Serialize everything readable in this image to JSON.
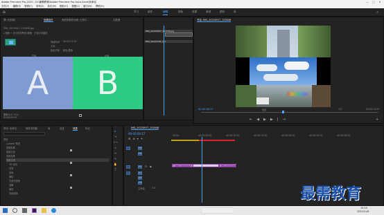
{
  "titlebar": {
    "title": "Adobe Premiere Pro 2020 - D:\\最需教育\\Adobe Premiere Pro Auto-Save\\未命名",
    "min": "—",
    "max": "□",
    "close": "✕"
  },
  "menubar": {
    "items": [
      "文件(F)",
      "编辑(E)",
      "剪辑(C)",
      "序列(S)",
      "标记(M)",
      "图形(G)",
      "视图(V)",
      "窗口(W)",
      "帮助(H)"
    ]
  },
  "workspaces": {
    "items": [
      "学习",
      "组件",
      "编辑",
      "颜色",
      "效果",
      "音频",
      "图形",
      "库"
    ],
    "active_index": 2
  },
  "effect_controls": {
    "tabs": [
      "效果控件",
      "源:(无剪辑)",
      "音频剪辑混合器: 已按计…",
      "元数据"
    ],
    "clip_title": "IMG_20220917_153408.jpg",
    "clip_line": "▸ 图像 > 未分类的黑色2图像 · 已按计划播放",
    "row_labels": [
      "持续时间",
      "方向",
      "颜色方案"
    ],
    "row_values": [
      "00:00:03:10",
      "",
      "黄色/黄绿"
    ],
    "duration_value": "00:00:03:10",
    "mode_value": "颜色/直通",
    "start_label": "开始",
    "end_label": "结束",
    "preview_a": "A",
    "preview_b": "B",
    "footer_left": "图像大小: 3/12",
    "footer_right": "00:00:00:00"
  },
  "source_mini": {
    "clips": [
      "IMG_20220917_153408.jpg",
      "IMG_20221005_1_1"
    ]
  },
  "program": {
    "tab": "节目: IMG_20220917_153408",
    "timecode": "00:00:04:17",
    "fit": "适合",
    "fraction": "1/2",
    "duration": "00:00:14:00",
    "transport": [
      "⇤",
      "◀",
      "▶",
      "▶|",
      "⇥"
    ]
  },
  "project": {
    "tabs": [
      "项目: 未命名",
      "媒体浏览器",
      "库",
      "信息",
      "效果",
      "标记"
    ],
    "active_tab": 4,
    "search_placeholder": "",
    "items": [
      "预设",
      "Lumetri 预设",
      "音频效果",
      "音频过渡",
      "视频效果",
      "视频过渡",
      "3D 运动",
      "内滑",
      "划像",
      "擦除",
      "沉浸式视频",
      "溶解",
      "缩放",
      "页面剥落"
    ]
  },
  "timeline": {
    "tab": "IMG_20220917_153408",
    "timecode": "00:00:04:17",
    "ruler": [
      "00:00",
      "00:00:05:00",
      "00:00:10:00",
      "00:00:15:00",
      "00:00:20:00",
      "00:00:25:00",
      "00:00:30:00"
    ],
    "tracks_video": [
      "V3",
      "V2",
      "V1"
    ],
    "tracks_audio": [
      "A1",
      "A2",
      "A3"
    ],
    "master": "主声道",
    "master_value": "0.0",
    "clip1": "IMG_20220917",
    "clip2": "IMG_20221005",
    "clip_color": "#c06fd4"
  },
  "watermark": "最需教育",
  "taskbar": {
    "time": "19:15",
    "date": "2022/11/8"
  },
  "colors": {
    "accent": "#4aa3ff",
    "panel": "#232323",
    "clip": "#c06fd4",
    "preview_a": "#7f9bd1",
    "preview_b": "#2ecb86"
  }
}
